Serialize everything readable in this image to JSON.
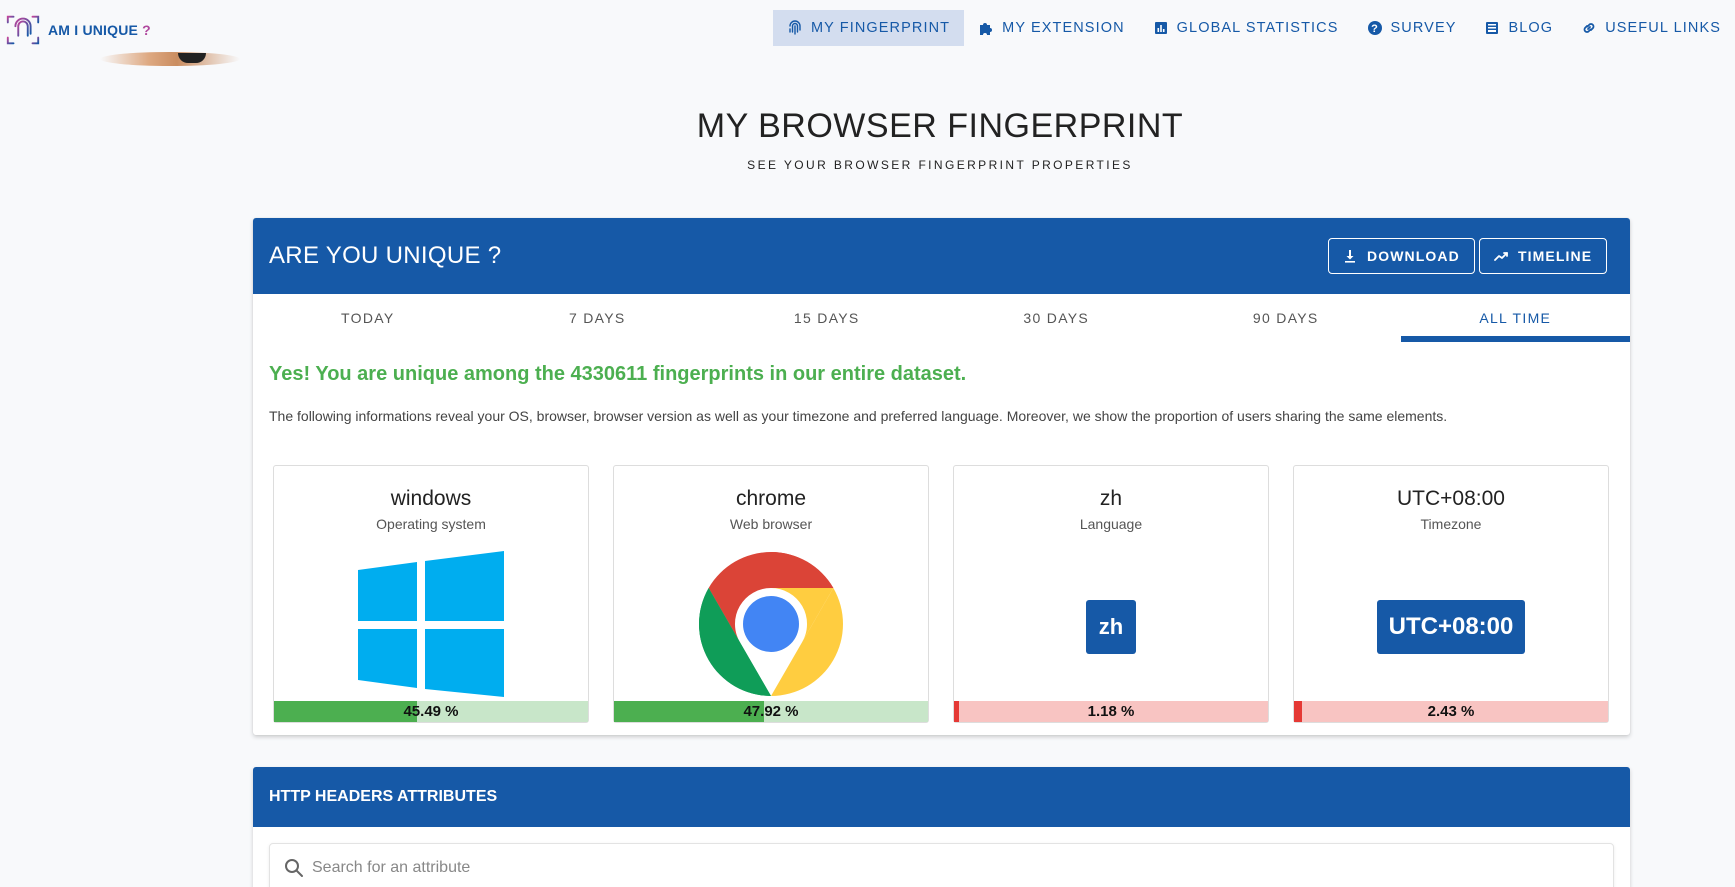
{
  "app": {
    "logo_text": "AM I UNIQUE",
    "logo_q": " ?"
  },
  "nav": [
    {
      "label": "MY FINGERPRINT",
      "icon": "fingerprint-icon"
    },
    {
      "label": "MY EXTENSION",
      "icon": "puzzle-icon"
    },
    {
      "label": "GLOBAL STATISTICS",
      "icon": "chart-icon"
    },
    {
      "label": "SURVEY",
      "icon": "help-icon"
    },
    {
      "label": "BLOG",
      "icon": "book-icon"
    },
    {
      "label": "USEFUL LINKS",
      "icon": "link-icon"
    }
  ],
  "hero": {
    "title": "MY BROWSER FINGERPRINT",
    "subtitle": "SEE YOUR BROWSER FINGERPRINT PROPERTIES"
  },
  "card": {
    "title": "ARE YOU UNIQUE ?",
    "download_label": "DOWNLOAD",
    "timeline_label": "TIMELINE",
    "tabs": [
      "TODAY",
      "7 DAYS",
      "15 DAYS",
      "30 DAYS",
      "90 DAYS",
      "ALL TIME"
    ],
    "active_tab": "ALL TIME",
    "unique_message": "Yes! You are unique among the 4330611 fingerprints in our entire dataset.",
    "info_text": "The following informations reveal your OS, browser, browser version as well as your timezone and preferred language. Moreover, we show the proportion of users sharing the same elements.",
    "tiles": [
      {
        "value": "windows",
        "label": "Operating system",
        "percent_text": "45.49 %",
        "percent": 45.49,
        "icon": "windows-logo"
      },
      {
        "value": "chrome",
        "label": "Web browser",
        "percent_text": "47.92 %",
        "percent": 47.92,
        "icon": "chrome-logo"
      },
      {
        "value": "zh",
        "label": "Language",
        "percent_text": "1.18 %",
        "percent": 1.18,
        "badge": "zh"
      },
      {
        "value": "UTC+08:00",
        "label": "Timezone",
        "percent_text": "2.43 %",
        "percent": 2.43,
        "badge": "UTC+08:00"
      }
    ]
  },
  "http_headers": {
    "title": "HTTP HEADERS ATTRIBUTES",
    "search_placeholder": "Search for an attribute"
  },
  "colors": {
    "primary": "#1659a7",
    "success": "#4caf50",
    "success_light": "#c8e6c9",
    "danger": "#e53935",
    "danger_light": "#f8c4c2"
  }
}
